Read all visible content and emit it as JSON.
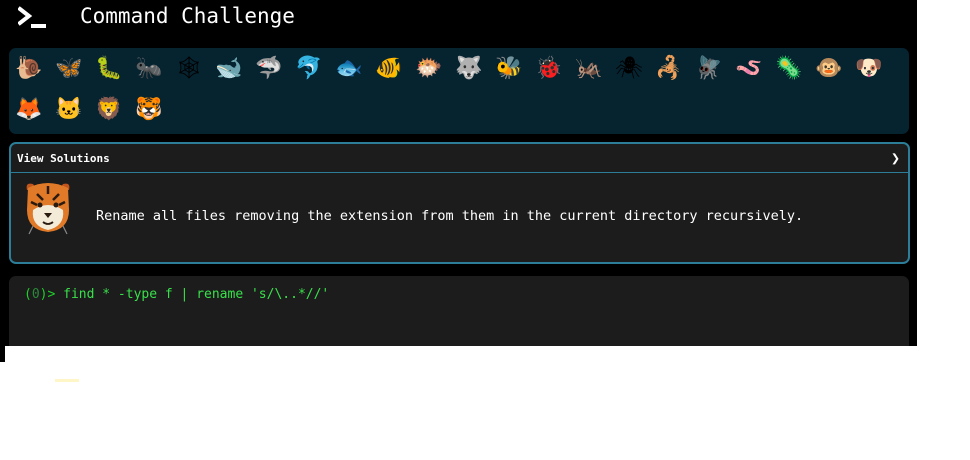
{
  "header": {
    "title": "Command Challenge",
    "logo_icon": "terminal-prompt-icon"
  },
  "levels": [
    {
      "icon": "snail-icon",
      "glyph": "🐌",
      "row": 0
    },
    {
      "icon": "butterfly-icon",
      "glyph": "🦋",
      "row": 0
    },
    {
      "icon": "caterpillar-icon",
      "glyph": "🐛",
      "row": 0
    },
    {
      "icon": "ant-icon",
      "glyph": "🐜",
      "row": 0
    },
    {
      "icon": "spider-web-icon",
      "glyph": "🕸",
      "row": 0
    },
    {
      "icon": "whale-icon",
      "glyph": "🐋",
      "row": 0
    },
    {
      "icon": "shark-icon",
      "glyph": "🦈",
      "row": 0
    },
    {
      "icon": "dolphin-icon",
      "glyph": "🐬",
      "row": 0
    },
    {
      "icon": "fish-icon",
      "glyph": "🐟",
      "row": 0
    },
    {
      "icon": "tropical-fish-icon",
      "glyph": "🐠",
      "row": 0
    },
    {
      "icon": "blowfish-icon",
      "glyph": "🐡",
      "row": 0
    },
    {
      "icon": "wolf-icon",
      "glyph": "🐺",
      "row": 0
    },
    {
      "icon": "bee-icon",
      "glyph": "🐝",
      "row": 0
    },
    {
      "icon": "ladybug-icon",
      "glyph": "🐞",
      "row": 0
    },
    {
      "icon": "cricket-icon",
      "glyph": "🦗",
      "row": 0
    },
    {
      "icon": "spider-icon",
      "glyph": "🕷",
      "row": 0
    },
    {
      "icon": "scorpion-icon",
      "glyph": "🦂",
      "row": 0
    },
    {
      "icon": "fly-icon",
      "glyph": "🪰",
      "row": 0
    },
    {
      "icon": "worm-icon",
      "glyph": "🪱",
      "row": 0
    },
    {
      "icon": "microbe-icon",
      "glyph": "🦠",
      "row": 0
    },
    {
      "icon": "monkey-icon",
      "glyph": "🐵",
      "row": 0
    },
    {
      "icon": "dog-icon",
      "glyph": "🐶",
      "row": 0
    },
    {
      "icon": "fox-icon",
      "glyph": "🦊",
      "row": 1
    },
    {
      "icon": "cat-icon",
      "glyph": "🐱",
      "row": 1
    },
    {
      "icon": "lion-icon",
      "glyph": "🦁",
      "row": 1
    },
    {
      "icon": "tiger-icon",
      "glyph": "🐯",
      "row": 1
    }
  ],
  "solutions": {
    "title": "View Solutions",
    "chevron_icon": "chevron-right-icon"
  },
  "challenge": {
    "avatar_icon": "tiger-icon",
    "avatar_glyph": "🐯",
    "description": "Rename all files removing the extension from them in the current directory recursively."
  },
  "terminal": {
    "prompt_open": "(",
    "prompt_number": "0",
    "prompt_close": ")> ",
    "command": "find * -type f | rename 's/\\..*//'"
  }
}
